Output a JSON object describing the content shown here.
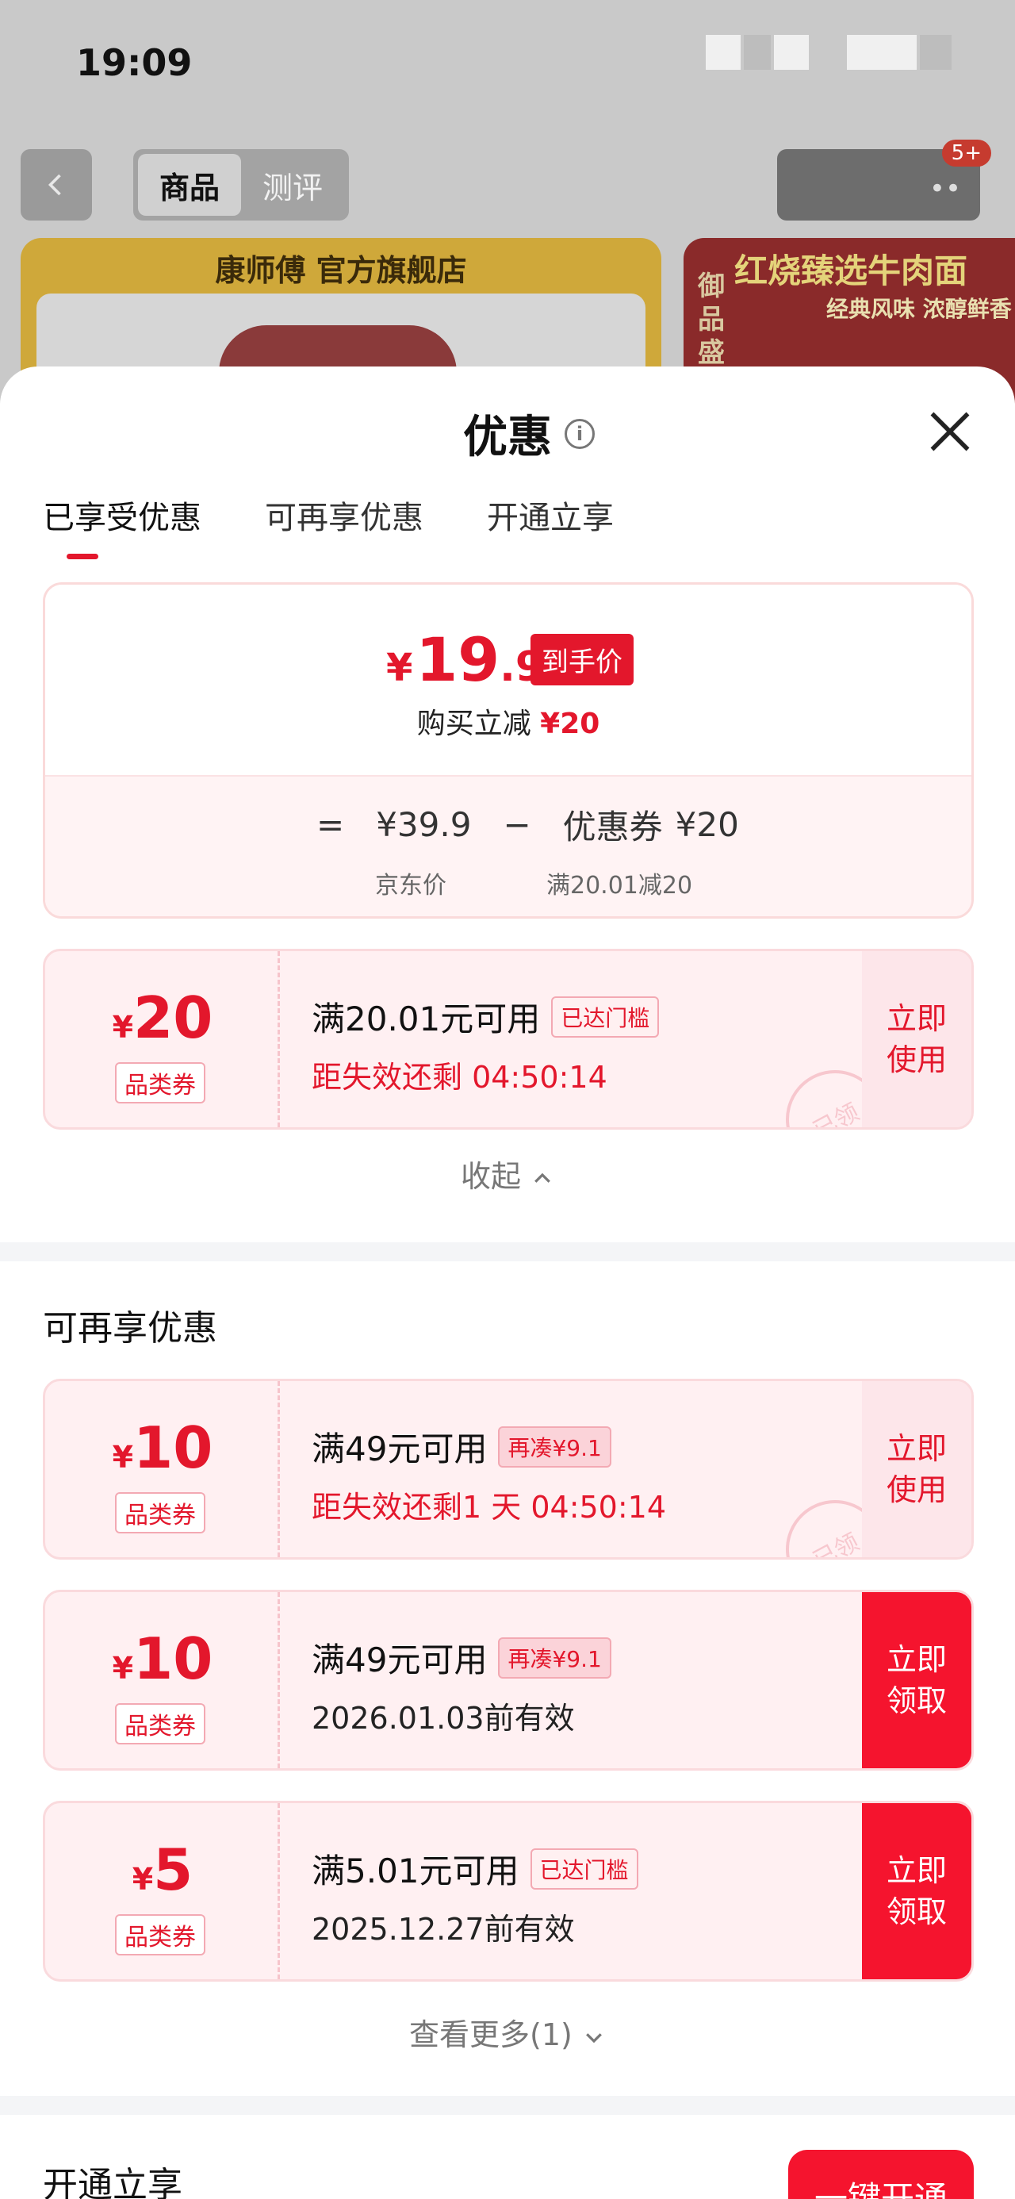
{
  "status_bar": {
    "time": "19:09"
  },
  "background": {
    "tabs": [
      "商品",
      "测评"
    ],
    "banner_left_title": "康师傅 官方旗舰店",
    "banner_right_title": "红烧臻选牛肉面",
    "banner_right_sub": "经典风味 浓醇鲜香",
    "banner_right_side": "御品盛宴",
    "badge": "5+"
  },
  "sheet": {
    "title": "优惠",
    "tabs": [
      "已享受优惠",
      "可再享优惠",
      "开通立享"
    ],
    "summary": {
      "currency": "¥",
      "price_int": "19",
      "price_dec": ".9",
      "price_tag": "到手价",
      "buy_save_label": "购买立减",
      "buy_save_value": "¥20",
      "eq": "=",
      "jd_price": "¥39.9",
      "minus": "−",
      "coupon_label": "优惠券",
      "coupon_value": "¥20",
      "jd_price_label": "京东价",
      "coupon_rule": "满20.01减20"
    },
    "used_coupon": {
      "currency": "¥",
      "amount": "20",
      "kind": "品类券",
      "condition": "满20.01元可用",
      "badge": "已达门槛",
      "sub": "距失效还剩 04:50:14",
      "action": "立即使用",
      "stamp": "已领"
    },
    "collapse_label": "收起",
    "more_section_title": "可再享优惠",
    "more_coupons": [
      {
        "currency": "¥",
        "amount": "10",
        "kind": "品类券",
        "condition": "满49元可用",
        "badge": "再凑¥9.1",
        "sub": "距失效还剩1 天 04:50:14",
        "action": "立即使用",
        "stamp": "已领"
      },
      {
        "currency": "¥",
        "amount": "10",
        "kind": "品类券",
        "condition": "满49元可用",
        "badge": "再凑¥9.1",
        "sub": "2026.01.03前有效",
        "action": "立即领取"
      },
      {
        "currency": "¥",
        "amount": "5",
        "kind": "品类券",
        "condition": "满5.01元可用",
        "badge": "已达门槛",
        "sub": "2025.12.27前有效",
        "action": "立即领取"
      }
    ],
    "see_more_label": "查看更多(1)",
    "open_section_title": "开通立享",
    "open_button": "一键开通"
  },
  "colors": {
    "accent": "#e3172c",
    "button_red": "#f5142e",
    "coupon_bg": "#fff0f2"
  }
}
